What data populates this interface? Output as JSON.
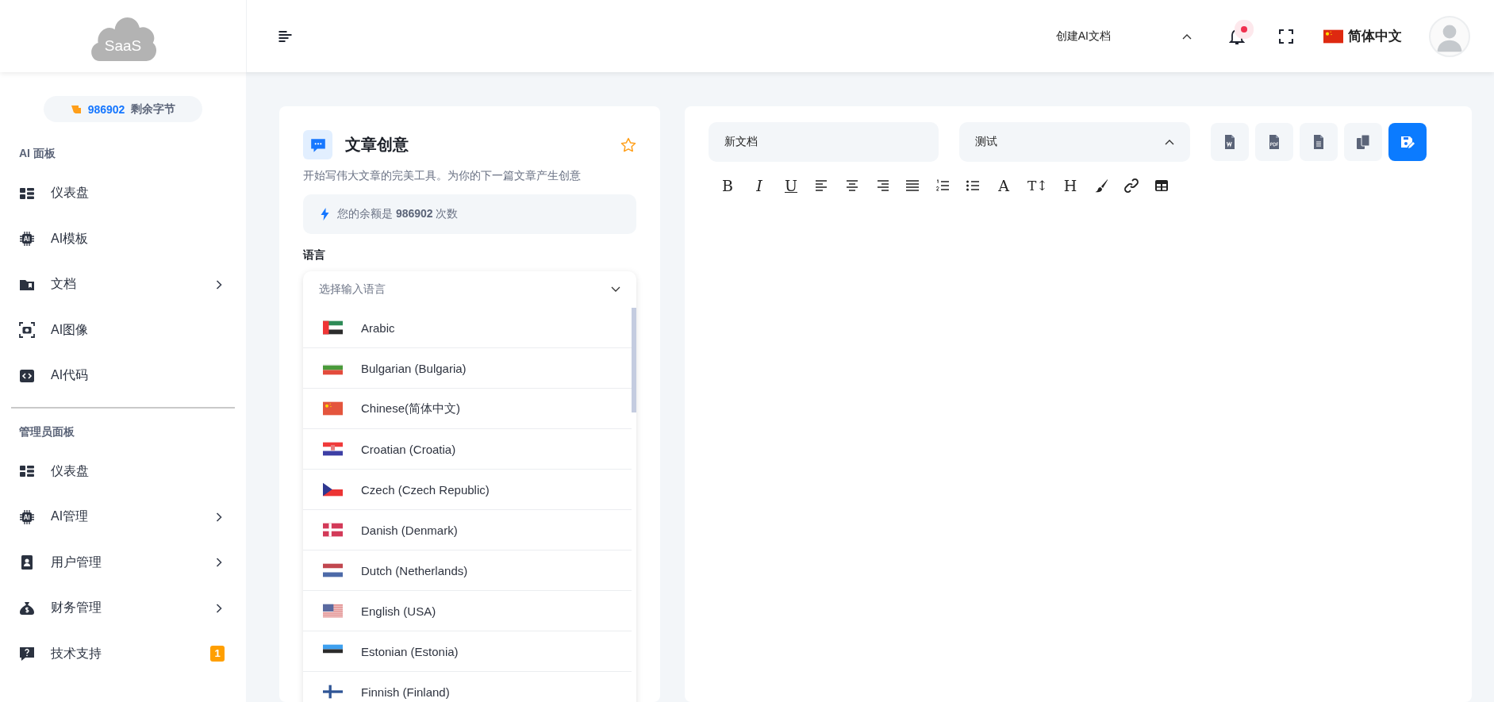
{
  "logo": {
    "text": "SaaS"
  },
  "header": {
    "doc_menu": {
      "label": "创建AI文档",
      "expanded": true
    },
    "notifications": {
      "unread": true
    },
    "language": {
      "label": "简体中文",
      "kind": "cn"
    }
  },
  "sidebar": {
    "balance": {
      "amount": "986902",
      "label": "剩余字节"
    },
    "sections": [
      {
        "title": "AI 面板",
        "items": [
          {
            "label": "仪表盘",
            "kind": "dashboard",
            "expandable": false
          },
          {
            "label": "AI模板",
            "kind": "chip",
            "expandable": false
          },
          {
            "label": "文档",
            "kind": "folder",
            "expandable": true
          },
          {
            "label": "AI图像",
            "kind": "camera",
            "expandable": false
          },
          {
            "label": "AI代码",
            "kind": "code",
            "expandable": false
          }
        ]
      },
      {
        "title": "管理员面板",
        "items": [
          {
            "label": "仪表盘",
            "kind": "dashboard",
            "expandable": false
          },
          {
            "label": "AI管理",
            "kind": "chip",
            "expandable": true
          },
          {
            "label": "用户管理",
            "kind": "user",
            "expandable": true
          },
          {
            "label": "财务管理",
            "kind": "money",
            "expandable": true
          },
          {
            "label": "技术支持",
            "kind": "help",
            "expandable": false,
            "badge": "1"
          }
        ]
      }
    ]
  },
  "tool": {
    "title": "文章创意",
    "favorite": false,
    "description": "开始写伟大文章的完美工具。为你的下一篇文章产生创意",
    "balance": "您的余额是 **986902** 次数",
    "language_label": "语言",
    "language_select": {
      "placeholder": "选择输入语言",
      "expanded": true,
      "options": [
        {
          "label": "Arabic",
          "kind": "ae"
        },
        {
          "label": "Bulgarian (Bulgaria)",
          "kind": "bg"
        },
        {
          "label": "Chinese(简体中文)",
          "kind": "cn"
        },
        {
          "label": "Croatian (Croatia)",
          "kind": "hr"
        },
        {
          "label": "Czech (Czech Republic)",
          "kind": "cz"
        },
        {
          "label": "Danish (Denmark)",
          "kind": "dk"
        },
        {
          "label": "Dutch (Netherlands)",
          "kind": "nl"
        },
        {
          "label": "English (USA)",
          "kind": "us"
        },
        {
          "label": "Estonian (Estonia)",
          "kind": "ee"
        },
        {
          "label": "Finnish (Finland)",
          "kind": "fi"
        }
      ]
    }
  },
  "editor": {
    "doc_name": "新文档",
    "folder": {
      "value": "测试",
      "expanded": true
    },
    "actions": [
      {
        "kind": "word"
      },
      {
        "kind": "pdf"
      },
      {
        "kind": "text"
      },
      {
        "kind": "copy"
      },
      {
        "kind": "save"
      }
    ],
    "toolbar": [
      {
        "kind": "bold",
        "glyph": "B"
      },
      {
        "kind": "italic",
        "glyph": "I"
      },
      {
        "kind": "underline",
        "glyph": "U"
      },
      {
        "kind": "align-left"
      },
      {
        "kind": "align-center"
      },
      {
        "kind": "align-right"
      },
      {
        "kind": "justify"
      },
      {
        "kind": "ordered-list"
      },
      {
        "kind": "bullet-list"
      },
      {
        "kind": "font",
        "glyph": "A"
      },
      {
        "kind": "size",
        "glyph": "T↕"
      },
      {
        "kind": "heading",
        "glyph": "H"
      },
      {
        "kind": "brush"
      },
      {
        "kind": "link"
      },
      {
        "kind": "table"
      }
    ]
  }
}
